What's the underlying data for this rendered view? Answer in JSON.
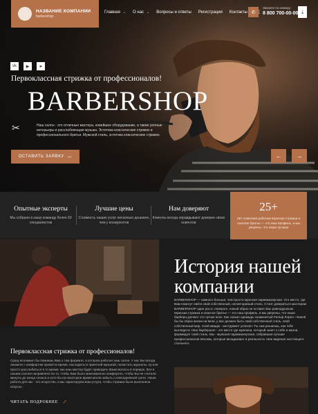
{
  "header": {
    "company_name": "НАЗВАНИЕ КОМПАНИИ",
    "company_sub": "barbershop",
    "nav": [
      {
        "label": "Главная",
        "has_dropdown": true
      },
      {
        "label": "О нас",
        "has_dropdown": true
      },
      {
        "label": "Вопросы и ответы",
        "has_dropdown": false
      },
      {
        "label": "Регистрация",
        "has_dropdown": false
      },
      {
        "label": "Контакты",
        "has_dropdown": false
      }
    ],
    "phone_label": "Звоните по номеру:",
    "phone": "8 800 700-00-00"
  },
  "hero": {
    "subtitle": "Первоклассная стрижка от профессионалов!",
    "title": "BARBERSHOP",
    "description": "Наш салон - это отличные мастера, новейшее оборудование, а также уютные интерьеры и расслабляющая музыка. Эстетика классических стрижек и профессионального бритья. Мужской стиль, эстетика классических стрижек.",
    "cta": "ОСТАВИТЬ ЗАЯВКУ",
    "socials": [
      "vk-icon",
      "youtube-icon",
      "telegram-icon"
    ]
  },
  "features": [
    {
      "title": "Опытные эксперты",
      "text": "Мы собрали в нашу команду более 60 специалистов"
    },
    {
      "title": "Лучшие цены",
      "text": "Стоимость наших услуг несколько дешевле, чем у конкурентов"
    },
    {
      "title": "Нам доверяют",
      "text": "Клиенты всегда оправдывают доверие своих клиентов"
    }
  ],
  "badge": {
    "number": "25+",
    "text": "Лет помогаем работам Мужская стрижка и опасное бритье — это наш профиль, и мы уверены, что наши лучшие"
  },
  "about": {
    "title_line1": "История нашей",
    "title_line2": "компании",
    "p1": "BARBERSHOP — намного больше, чем просто мужская парикмахерская. Это место, где Вам помогут найти свой собственный, неповторимый стиль. Стоит довериться мастерам BARBERSHOP один раз и, поверьте, новый образ не оставит Вас равнодушным.",
    "p2": "Мужская стрижка и опасное бритье — это наш профиль, и мы уверены, что наши барберы делают это лучше всех. Как сказал однажды знаменитый Ральф Лорен: «Какой бы бы образ жизни ни вели, у вас должен быть свой собственный стиль, свой собственный мир. Свой имидж - инструмент успеха!» Ты сам решаешь, как тебе выглядеть! Наш барбершоп - это место где мужчина, который знает о себе и жизни, формирует свой стиль. Мы - мужская парикмахерская, собравшая лучшие профессионалов Москвы, которые вкладывают в реальность твое видение настоящего стильного."
  },
  "left": {
    "subtitle": "Первоклассная стрижка от профессионалов!",
    "text": "Сразу вспомнил бы помнишь Вам о том формате, в котором работал наш салон. У нас Вы всегда сможете с комфортом провести время, насладиться приятной музыкой, полистать журналы, ну или просто расслабиться в то время, как наш мастер будет приводить Ваши волосы в порядок. Все в нашем салоне направлено на то, чтобы Вам было максимально комфортно, чтобы Вы не считали минуты до конца сеанса и хотя бы на некоторое время могли забыть о повседневной суете. Наша работа для нас - это искусство, и мы гарантируем вам услуги, чтобы стрижка была выполнена искусно.",
    "more": "ЧИТАТЬ ПОДРОБНЕЕ"
  },
  "colors": {
    "accent": "#b5714a",
    "dark": "#1b1b1b",
    "panel": "#222222"
  }
}
